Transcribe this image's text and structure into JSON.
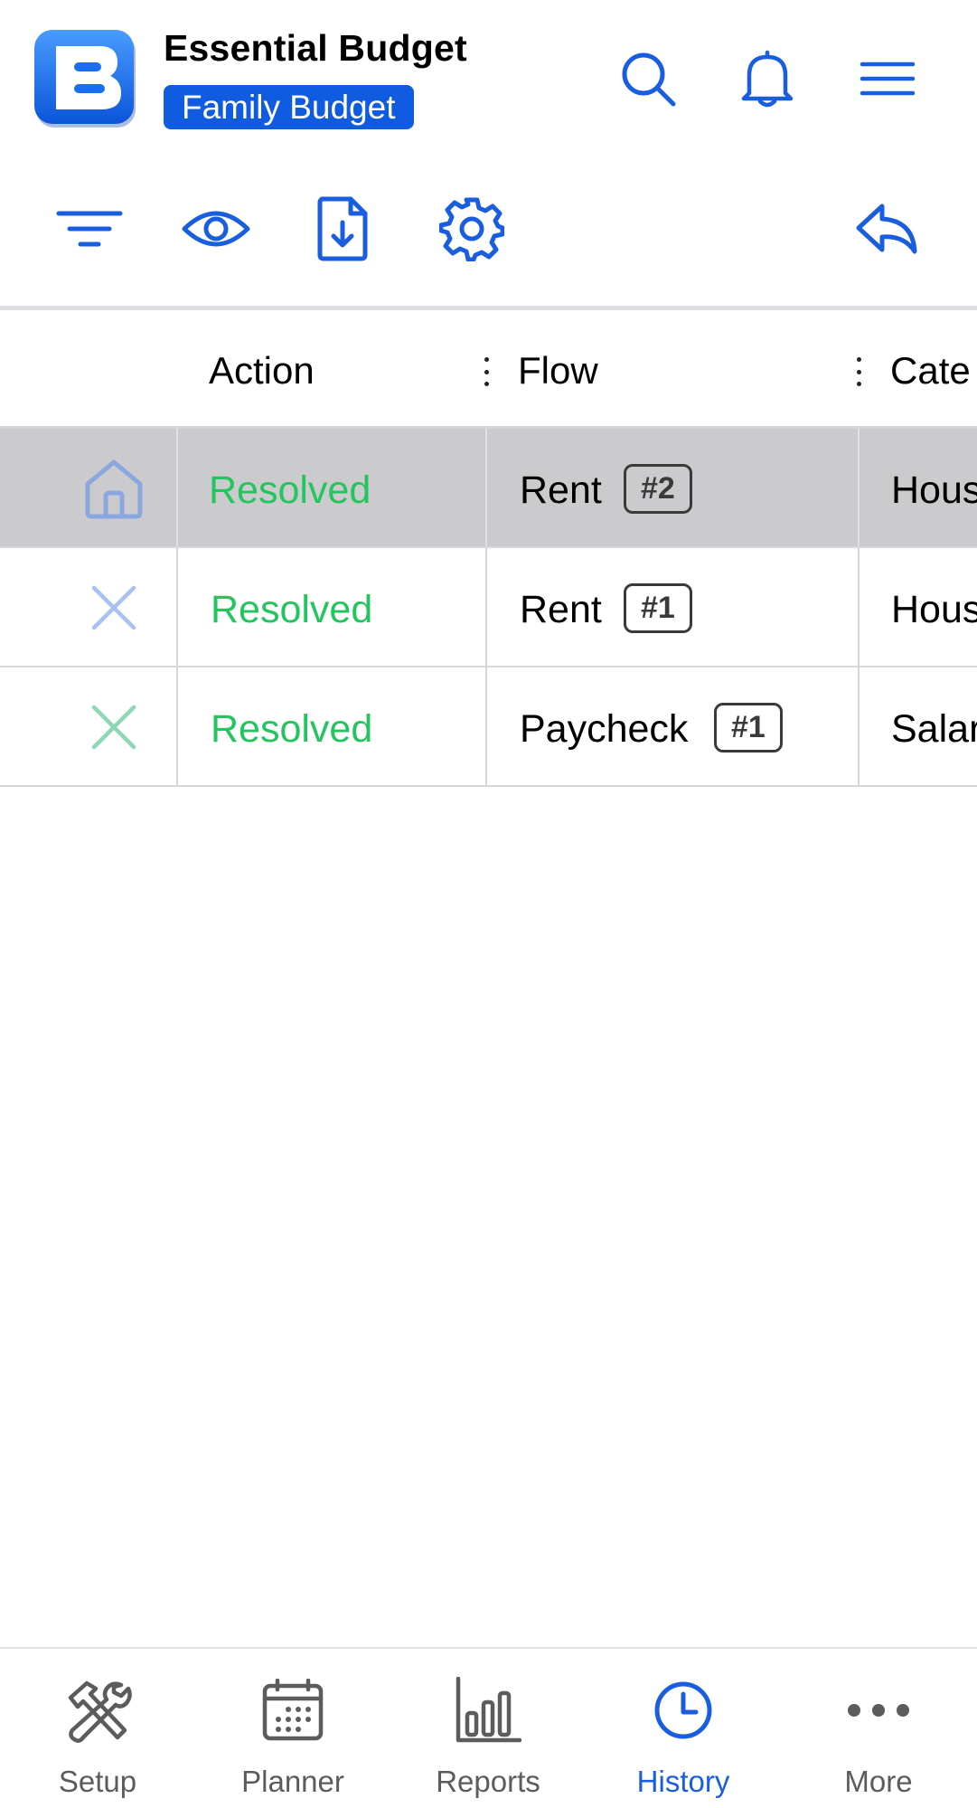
{
  "colors": {
    "accent": "#1a5ee0",
    "badge_bg": "#0f5ce0",
    "resolved": "#22c55e",
    "selected_row": "#cbcbcd",
    "nav_inactive": "#5c5c5c"
  },
  "header": {
    "logo_icon": "essential-budget-logo",
    "title": "Essential Budget",
    "budget_name": "Family Budget",
    "icons": [
      "search-icon",
      "bell-icon",
      "hamburger-menu-icon"
    ]
  },
  "toolbar": {
    "icons": [
      "filter-icon",
      "eye-icon",
      "download-file-icon",
      "gear-icon",
      "undo-icon"
    ]
  },
  "table": {
    "columns": [
      {
        "label": "Action"
      },
      {
        "label": "Flow"
      },
      {
        "label": "Cate"
      }
    ],
    "rows": [
      {
        "icon": "home-icon",
        "action": "Resolved",
        "flow": "Rent",
        "tag": "#2",
        "category": "Hous",
        "selected": true
      },
      {
        "icon": "close-icon",
        "action": "Resolved",
        "flow": "Rent",
        "tag": "#1",
        "category": "Hous",
        "selected": false
      },
      {
        "icon": "close-icon",
        "action": "Resolved",
        "flow": "Paycheck",
        "tag": "#1",
        "category": "Salar",
        "selected": false
      }
    ]
  },
  "bottom_nav": {
    "items": [
      {
        "label": "Setup",
        "icon": "tools-icon",
        "active": false
      },
      {
        "label": "Planner",
        "icon": "calendar-icon",
        "active": false
      },
      {
        "label": "Reports",
        "icon": "bar-chart-icon",
        "active": false
      },
      {
        "label": "History",
        "icon": "clock-icon",
        "active": true
      },
      {
        "label": "More",
        "icon": "more-dots-icon",
        "active": false
      }
    ]
  }
}
